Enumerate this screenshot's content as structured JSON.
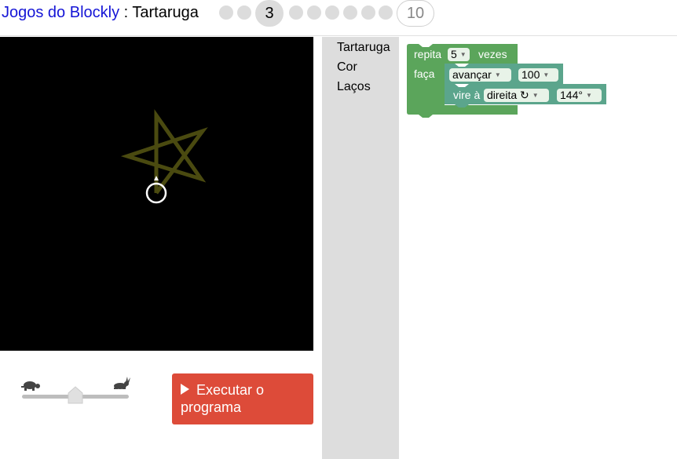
{
  "header": {
    "app_name": "Jogos do Blockly",
    "separator": " : ",
    "game_name": "Tartaruga",
    "current_level": "3",
    "last_level": "10"
  },
  "speed": {
    "slow_icon": "turtle-icon",
    "fast_icon": "rabbit-icon",
    "value": 0.5
  },
  "run_button": {
    "icon": "play-icon",
    "label": "Executar o programa"
  },
  "toolbox": {
    "categories": [
      "Tartaruga",
      "Cor",
      "Laços"
    ]
  },
  "blocks": {
    "repeat": {
      "label_repeat": "repita",
      "count": "5",
      "label_times": "vezes",
      "label_do": "faça"
    },
    "move": {
      "direction": "avançar",
      "amount": "100"
    },
    "turn": {
      "label": "vire à",
      "direction": "direita ↻",
      "angle": "144°"
    }
  },
  "colors": {
    "link": "#1515d6",
    "run_button": "#dd4b39",
    "loop_block": "#5ba55b",
    "turtle_block": "#5ba58c",
    "star_stroke": "#4a4a10",
    "toolbox_bg": "#dddddd"
  }
}
